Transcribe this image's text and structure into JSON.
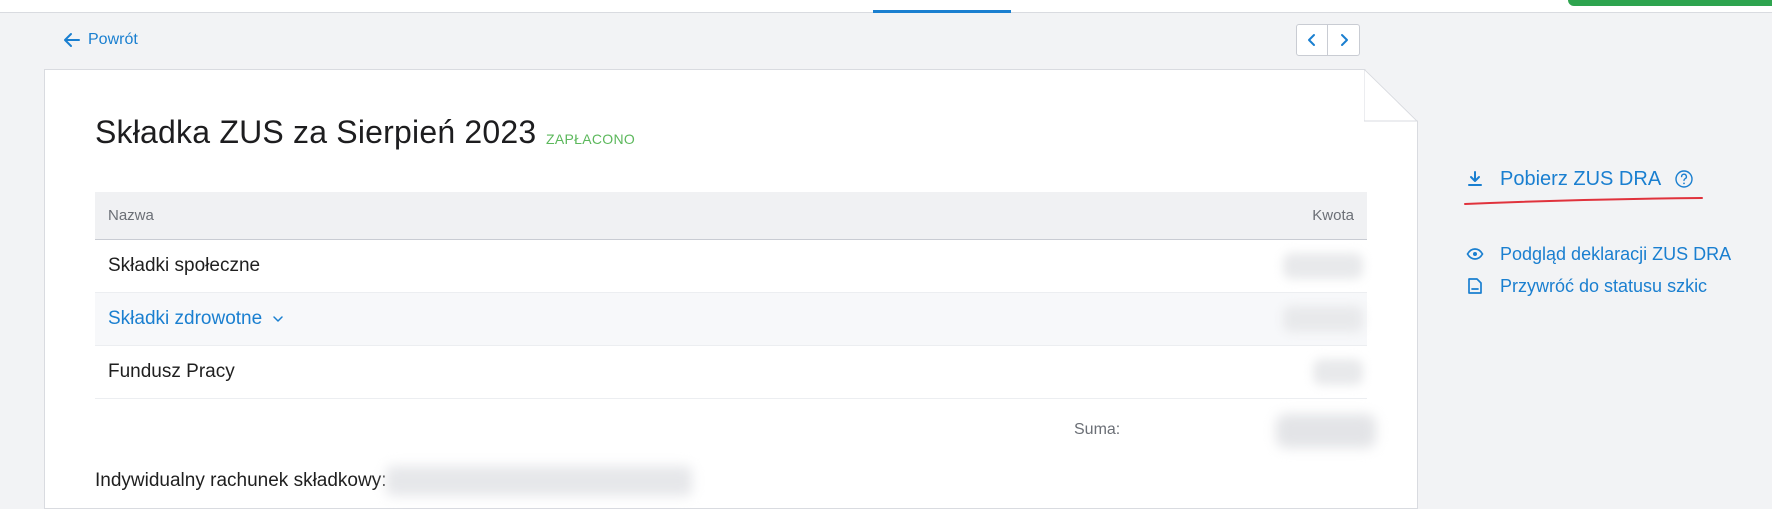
{
  "nav": {
    "back_label": "Powrót"
  },
  "document": {
    "title": "Składka ZUS za Sierpień 2023",
    "status": "ZAPŁACONO",
    "table": {
      "header_name": "Nazwa",
      "header_amount": "Kwota",
      "rows": [
        {
          "name": "Składki społeczne"
        },
        {
          "name": "Składki zdrowotne"
        },
        {
          "name": "Fundusz Pracy"
        }
      ]
    },
    "sum_label": "Suma:",
    "account_label": "Indywidualny rachunek składkowy:"
  },
  "actions": {
    "download": "Pobierz ZUS DRA",
    "preview": "Podgląd deklaracji ZUS DRA",
    "restore": "Przywróć do statusu szkic"
  },
  "colors": {
    "accent": "#1a7fd0",
    "status_paid": "#5cb85c",
    "annotation": "#e0323c"
  },
  "icons": {
    "back": "arrow-left-icon",
    "prev": "chevron-left-icon",
    "next": "chevron-right-icon",
    "expand": "chevron-down-icon",
    "download": "download-icon",
    "help": "help-circle-icon",
    "preview": "eye-icon",
    "restore": "document-icon"
  }
}
